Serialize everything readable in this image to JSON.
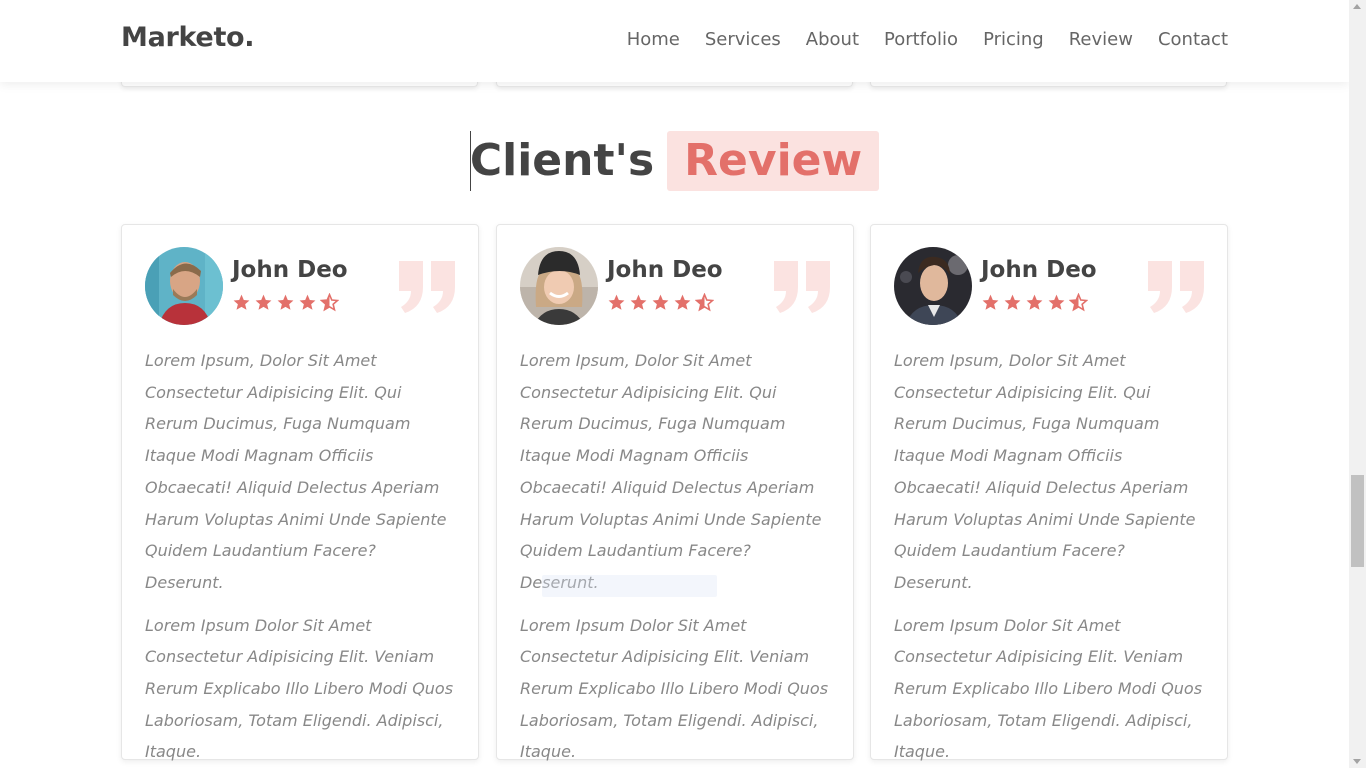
{
  "header": {
    "logo": "Marketo.",
    "nav": [
      "Home",
      "Services",
      "About",
      "Portfolio",
      "Pricing",
      "Review",
      "Contact"
    ]
  },
  "section": {
    "title_main": "Client's",
    "title_accent": "Review"
  },
  "reviews": [
    {
      "name": "John Deo",
      "rating": 4.5,
      "paragraphs": [
        "Lorem Ipsum, Dolor Sit Amet Consectetur Adipisicing Elit. Qui Rerum Ducimus, Fuga Numquam Itaque Modi Magnam Officiis Obcaecati! Aliquid Delectus Aperiam Harum Voluptas Animi Unde Sapiente Quidem Laudantium Facere? Deserunt.",
        "Lorem Ipsum Dolor Sit Amet Consectetur Adipisicing Elit. Veniam Rerum Explicabo Illo Libero Modi Quos Laboriosam, Totam Eligendi. Adipisci, Itaque."
      ]
    },
    {
      "name": "John Deo",
      "rating": 4.5,
      "paragraphs": [
        "Lorem Ipsum, Dolor Sit Amet Consectetur Adipisicing Elit. Qui Rerum Ducimus, Fuga Numquam Itaque Modi Magnam Officiis Obcaecati! Aliquid Delectus Aperiam Harum Voluptas Animi Unde Sapiente Quidem Laudantium Facere? Deserunt.",
        "Lorem Ipsum Dolor Sit Amet Consectetur Adipisicing Elit. Veniam Rerum Explicabo Illo Libero Modi Quos Laboriosam, Totam Eligendi. Adipisci, Itaque."
      ]
    },
    {
      "name": "John Deo",
      "rating": 4.5,
      "paragraphs": [
        "Lorem Ipsum, Dolor Sit Amet Consectetur Adipisicing Elit. Qui Rerum Ducimus, Fuga Numquam Itaque Modi Magnam Officiis Obcaecati! Aliquid Delectus Aperiam Harum Voluptas Animi Unde Sapiente Quidem Laudantium Facere? Deserunt.",
        "Lorem Ipsum Dolor Sit Amet Consectetur Adipisicing Elit. Veniam Rerum Explicabo Illo Libero Modi Quos Laboriosam, Totam Eligendi. Adipisci, Itaque."
      ]
    }
  ],
  "colors": {
    "accent": "#e3706a",
    "accent_bg": "#fbe2e0",
    "quote_icon": "#fbe3e1",
    "text": "#444444",
    "muted": "#888888"
  },
  "icons": {
    "star": "star-icon",
    "half_star": "star-half-icon",
    "quote": "quote-right-icon"
  }
}
